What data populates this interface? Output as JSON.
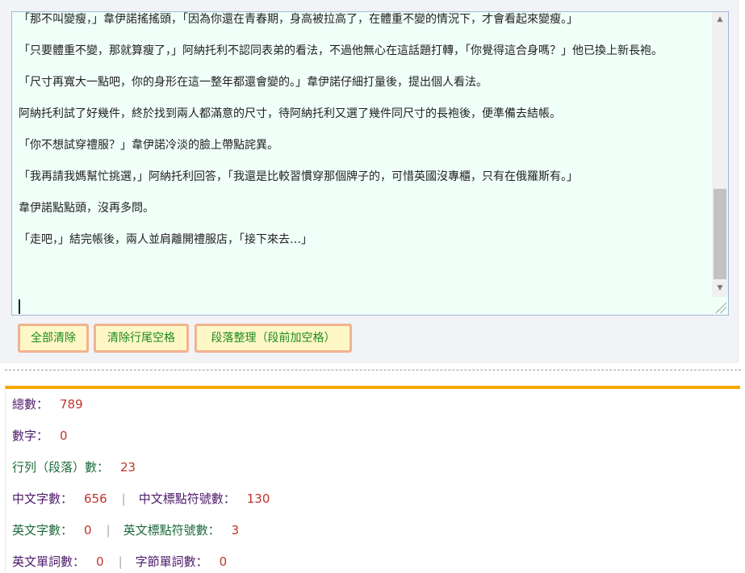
{
  "editor": {
    "paragraphs": [
      "「那不叫變瘦，」韋伊諾搖搖頭，「因為你還在青春期，身高被拉高了，在體重不變的情況下，才會看起來變瘦。」",
      "「只要體重不變，那就算瘦了，」阿納托利不認同表弟的看法，不過他無心在這話題打轉，「你覺得這合身嗎？」他已換上新長袍。",
      "「尺寸再寬大一點吧，你的身形在這一整年都還會變的。」韋伊諾仔細打量後，提出個人看法。",
      "阿納托利試了好幾件，終於找到兩人都滿意的尺寸，待阿納托利又選了幾件同尺寸的長袍後，便準備去結帳。",
      "「你不想試穿禮服？」韋伊諾冷淡的臉上帶點詫異。",
      "「我再請我媽幫忙挑選，」阿納托利回答，「我還是比較習慣穿那個牌子的，可惜英國沒專櫃，只有在俄羅斯有。」",
      "韋伊諾點點頭，沒再多問。",
      "「走吧，」結完帳後，兩人並肩離開禮服店，「接下來去…」"
    ]
  },
  "buttons": {
    "clear_all": "全部清除",
    "trim_trailing": "清除行尾空格",
    "paragraph_tidy": "段落整理（段前加空格）"
  },
  "stats": {
    "total_label": "總數：",
    "total_value": "789",
    "digits_label": "數字：",
    "digits_value": "0",
    "lines_label": "行列（段落）數：",
    "lines_value": "23",
    "cn_chars_label": "中文字數：",
    "cn_chars_value": "656",
    "cn_punct_label": "中文標點符號數：",
    "cn_punct_value": "130",
    "en_chars_label": "英文字數：",
    "en_chars_value": "0",
    "en_punct_label": "英文標點符號數：",
    "en_punct_value": "3",
    "en_words_label": "英文單詞數：",
    "en_words_value": "0",
    "syllable_words_label": "字節單詞數：",
    "syllable_words_value": "0",
    "separator": "|"
  },
  "colors": {
    "accent_bar": "#f5a800",
    "button_bg": "#fff8c6",
    "button_border": "#f2b38e",
    "button_text": "#1f8a1f",
    "value_text": "#c0332b"
  }
}
